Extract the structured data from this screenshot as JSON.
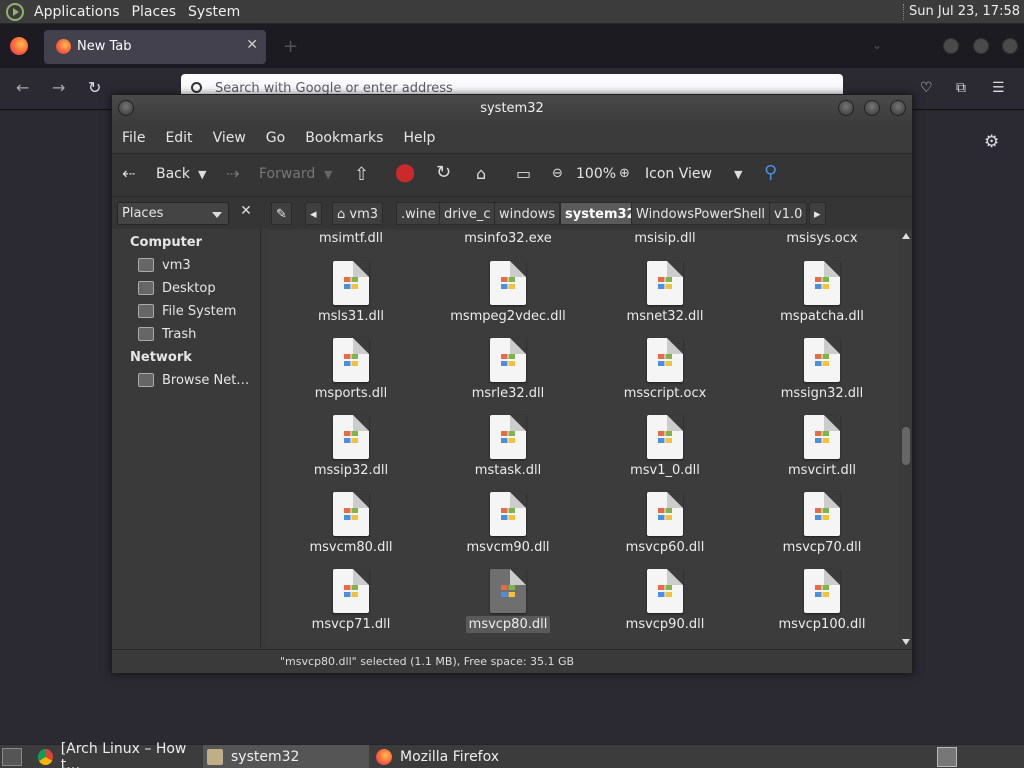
{
  "top_panel": {
    "menus": [
      "Applications",
      "Places",
      "System"
    ],
    "clock": "Sun Jul 23, 17:58"
  },
  "firefox": {
    "tab_label": "New Tab",
    "url_placeholder": "Search with Google or enter address"
  },
  "nautilus": {
    "title": "system32",
    "menu": [
      "File",
      "Edit",
      "View",
      "Go",
      "Bookmarks",
      "Help"
    ],
    "toolbar": {
      "back": "Back",
      "forward": "Forward",
      "zoom": "100%",
      "view_mode": "Icon View"
    },
    "places_combo": "Places",
    "breadcrumbs": [
      "vm3",
      ".wine",
      "drive_c",
      "windows",
      "system32",
      "WindowsPowerShell",
      "v1.0"
    ],
    "sidebar": {
      "computer_heading": "Computer",
      "computer_items": [
        "vm3",
        "Desktop",
        "File System",
        "Trash"
      ],
      "network_heading": "Network",
      "network_items": [
        "Browse Net…"
      ]
    },
    "partial_row": [
      "msimtf.dll",
      "msinfo32.exe",
      "msisip.dll",
      "msisys.ocx"
    ],
    "files": [
      [
        "msls31.dll",
        "msmpeg2vdec.dll",
        "msnet32.dll",
        "mspatcha.dll"
      ],
      [
        "msports.dll",
        "msrle32.dll",
        "msscript.ocx",
        "mssign32.dll"
      ],
      [
        "mssip32.dll",
        "mstask.dll",
        "msv1_0.dll",
        "msvcirt.dll"
      ],
      [
        "msvcm80.dll",
        "msvcm90.dll",
        "msvcp60.dll",
        "msvcp70.dll"
      ],
      [
        "msvcp71.dll",
        "msvcp80.dll",
        "msvcp90.dll",
        "msvcp100.dll"
      ]
    ],
    "selected_file": "msvcp80.dll",
    "status": "\"msvcp80.dll\" selected (1.1 MB), Free space: 35.1 GB"
  },
  "taskbar": {
    "tasks": [
      "[Arch Linux – How t…",
      "system32",
      "Mozilla Firefox"
    ]
  }
}
